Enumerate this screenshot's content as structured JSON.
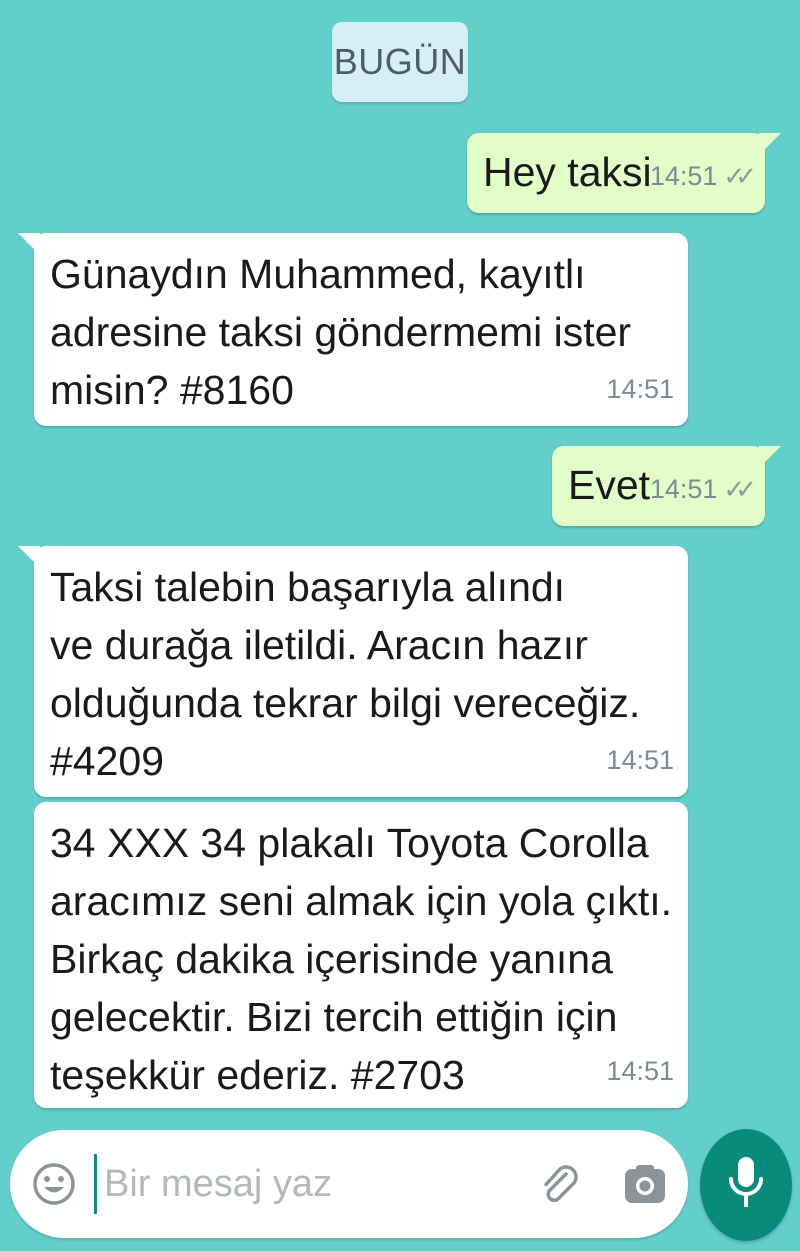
{
  "date_chip": "BUGÜN",
  "messages": [
    {
      "direction": "out",
      "text": "Hey taksi",
      "time": "14:51",
      "status": "read"
    },
    {
      "direction": "in",
      "text": "Günaydın Muhammed, kayıtlı\nadresine taksi göndermemi ister\nmisin? #8160",
      "time": "14:51"
    },
    {
      "direction": "out",
      "text": "Evet",
      "time": "14:51",
      "status": "read"
    },
    {
      "direction": "in",
      "text": "Taksi talebin başarıyla alındı\nve durağa iletildi. Aracın hazır\nolduğunda tekrar bilgi vereceğiz.\n#4209",
      "time": "14:51"
    },
    {
      "direction": "in",
      "text": "34 XXX 34 plakalı Toyota Corolla\naracımız seni almak için yola çıktı.\nBirkaç dakika içerisinde yanına\ngelecektir. Bizi tercih ettiğin için\nteşekkür ederiz. #2703",
      "time": "14:51"
    }
  ],
  "composer": {
    "placeholder": "Bir mesaj yaz",
    "value": "",
    "icons": [
      "emoji-icon",
      "attachment-icon",
      "camera-icon",
      "microphone-icon"
    ]
  },
  "colors": {
    "background": "#63cfcb",
    "outgoing_bubble": "#e3fdc9",
    "incoming_bubble": "#ffffff",
    "accent": "#098b7c"
  }
}
